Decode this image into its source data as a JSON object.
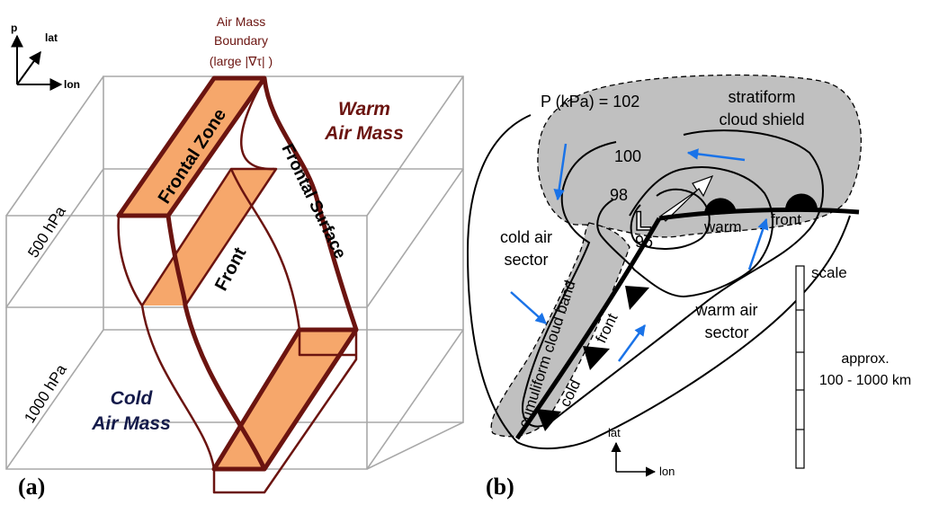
{
  "panel_a": {
    "panel_label": "(a)",
    "axes": {
      "vertical": "p",
      "diagonal": "lat",
      "horizontal": "lon"
    },
    "boundary_title_line1": "Air Mass",
    "boundary_title_line2": "Boundary",
    "boundary_title_line3": "(large |∇τ| )",
    "frontal_zone": "Frontal Zone",
    "warm_mass_line1": "Warm",
    "warm_mass_line2": "Air Mass",
    "frontal_surface": "Frontal Surface",
    "front": "Front",
    "level_500": "500 hPa",
    "level_1000": "1000 hPa",
    "cold_mass_line1": "Cold",
    "cold_mass_line2": "Air Mass",
    "colors": {
      "boundary": "#6b1410",
      "zone_fill": "#f6a76b",
      "box": "#a8a8a8",
      "warm_text": "#6b1410",
      "cold_text": "#141a4a"
    }
  },
  "panel_b": {
    "panel_label": "(b)",
    "pressure_label": "P (kPa) = 102",
    "isobar_100": "100",
    "isobar_98": "98",
    "isobar_96": "96",
    "low_symbol": "L",
    "stratiform_line1": "stratiform",
    "stratiform_line2": "cloud shield",
    "cold_sector_line1": "cold air",
    "cold_sector_line2": "sector",
    "cumuliform": "cumuliform cloud band",
    "cold_front_word1": "cold",
    "cold_front_word2": "front",
    "warm_front_word1": "warm",
    "warm_front_word2": "front",
    "warm_sector_line1": "warm air",
    "warm_sector_line2": "sector",
    "scale_title": "scale",
    "scale_line1": "approx.",
    "scale_line2": "100 - 1000 km",
    "axes": {
      "vertical": "lat",
      "horizontal": "lon"
    },
    "colors": {
      "cloud": "#c0c0c0",
      "arrow": "#1a73e8",
      "front": "#000000"
    }
  }
}
